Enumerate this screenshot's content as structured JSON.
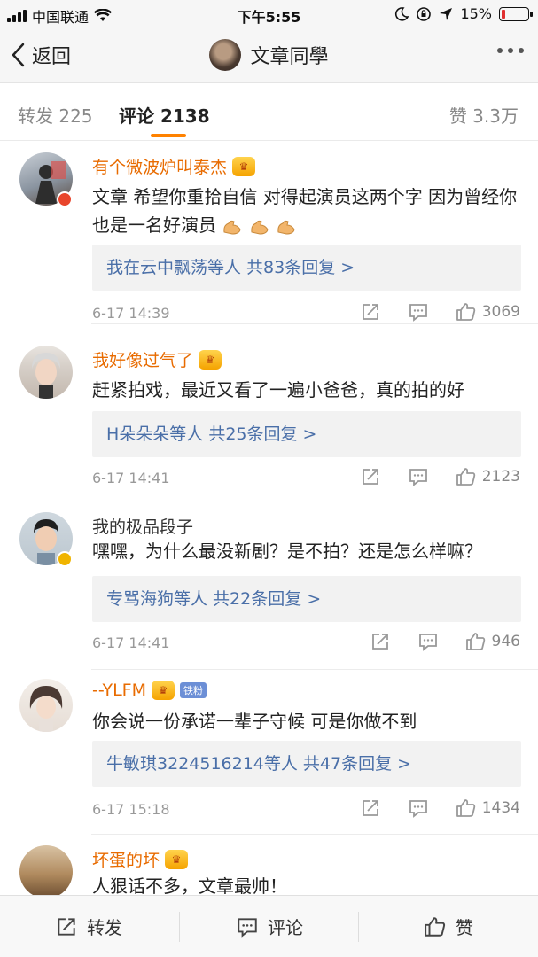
{
  "status_bar": {
    "carrier": "中国联通",
    "time": "下午5:55",
    "battery": "15%",
    "battery_level": 0.15
  },
  "nav": {
    "back_label": "返回",
    "title": "文章同學"
  },
  "tabs": {
    "repost": "转发 225",
    "comments": "评论 2138",
    "likes": "赞 3.3万"
  },
  "comments": [
    {
      "name": "有个微波炉叫泰杰",
      "text": "文章 希望你重拾自信 对得起演员这两个字 因为曾经你也是一名好演员",
      "emoji": "muscle",
      "reply": "我在云中飘荡等人  共83条回复 >",
      "time": "6-17 14:39",
      "likes": "3069"
    },
    {
      "name": "我好像过气了",
      "text": "赶紧拍戏，最近又看了一遍小爸爸，真的拍的好",
      "reply": "H朵朵朵等人  共25条回复 >",
      "time": "6-17 14:41",
      "likes": "2123"
    },
    {
      "name": "我的极品段子",
      "text": "嘿嘿，为什么最没新剧？是不拍？还是怎么样嘛？",
      "reply": "专骂海狗等人  共22条回复 >",
      "time": "6-17 14:41",
      "likes": "946"
    },
    {
      "name": "--YLFM",
      "badge": "铁粉",
      "text": "你会说一份承诺一辈子守候 可是你做不到",
      "reply": "牛敏琪3224516214等人  共47条回复 >",
      "time": "6-17 15:18",
      "likes": "1434"
    },
    {
      "name": "坏蛋的坏",
      "text": "人狠话不多，文章最帅！"
    }
  ],
  "bottom_bar": {
    "repost": "转发",
    "comment": "评论",
    "like": "赞"
  },
  "colors": {
    "accent": "#ff8200",
    "username": "#e86b00",
    "link": "#4a6fa8"
  }
}
